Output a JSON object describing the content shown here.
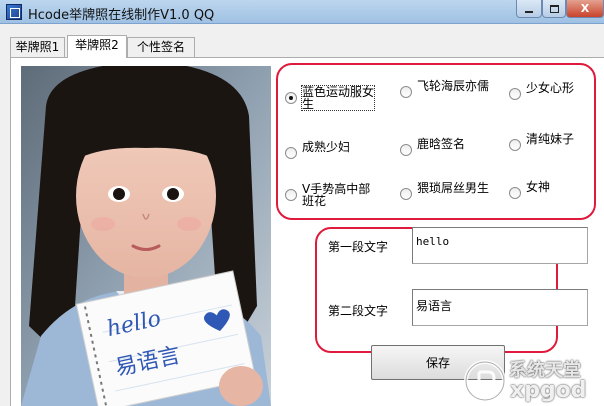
{
  "window": {
    "title": "Hcode举牌照在线制作V1.0   QQ",
    "minimize_icon": "minimize-icon",
    "maximize_icon": "maximize-icon",
    "close_icon": "close-icon",
    "close_label": "X"
  },
  "tabs": [
    {
      "label": "举牌照1",
      "active": false
    },
    {
      "label": "举牌照2",
      "active": true
    },
    {
      "label": "个性签名",
      "active": false
    }
  ],
  "photo": {
    "sign_text_line1": "hello",
    "sign_text_line2": "易语言"
  },
  "styles": {
    "options": [
      {
        "label": "蓝色运动服女生",
        "selected": true
      },
      {
        "label": "飞轮海辰亦儒",
        "selected": false
      },
      {
        "label": "少女心形",
        "selected": false
      },
      {
        "label": "成熟少妇",
        "selected": false
      },
      {
        "label": "鹿晗签名",
        "selected": false
      },
      {
        "label": "清纯妹子",
        "selected": false
      },
      {
        "label": "V手势高中部班花",
        "selected": false
      },
      {
        "label": "猥琐屌丝男生",
        "selected": false
      },
      {
        "label": "女神",
        "selected": false
      }
    ]
  },
  "fields": {
    "first_label": "第一段文字",
    "first_value": "hello",
    "second_label": "第二段文字",
    "second_value": "易语言"
  },
  "save_button": {
    "label": "保存"
  },
  "watermark": {
    "line1": "系统天堂",
    "line2": "xpgod"
  },
  "colors": {
    "highlight_frame": "#e01a3c",
    "titlebar": "#bcd6ee",
    "close_button": "#c9432c"
  }
}
